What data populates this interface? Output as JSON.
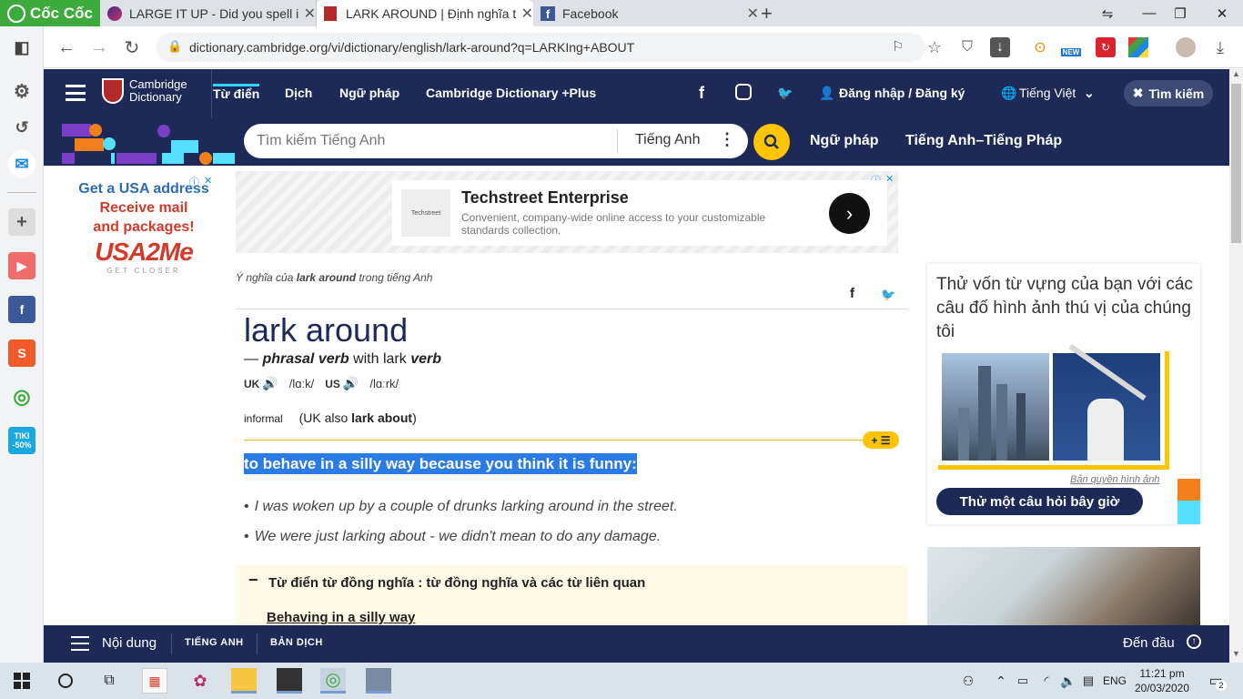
{
  "tabs": [
    {
      "label": "Cốc Cốc",
      "active": false
    },
    {
      "label": "LARGE IT UP - Did you spell it",
      "active": false
    },
    {
      "label": "LARK AROUND | Định nghĩa t",
      "active": true
    },
    {
      "label": "Facebook",
      "active": false
    }
  ],
  "address": {
    "url": "dictionary.cambridge.org/vi/dictionary/english/lark-around?q=LARKIng+ABOUT"
  },
  "toolbar": {
    "new_badge": "NEW"
  },
  "sidebar": {
    "tiki_label": "TIKI",
    "tiki_badge": "-50%"
  },
  "header": {
    "logo_line1": "Cambridge",
    "logo_line2": "Dictionary",
    "nav": [
      "Từ điển",
      "Dịch",
      "Ngữ pháp",
      "Cambridge Dictionary +Plus"
    ],
    "login": "Đăng nhập / Đăng ký",
    "language": "Tiếng Việt",
    "close_search": "Tìm kiếm"
  },
  "search": {
    "placeholder": "Tìm kiếm Tiếng Anh",
    "dictionary": "Tiếng Anh",
    "links": [
      "Ngữ pháp",
      "Tiếng Anh–Tiếng Pháp"
    ]
  },
  "ads": {
    "left": {
      "line1": "Get a USA address",
      "line2": "Receive mail",
      "line3": "and packages!",
      "brand": "USA2Me",
      "tagline": "GET CLOSER"
    },
    "top": {
      "title": "Techstreet Enterprise",
      "body": "Convenient, company-wide online access to your customizable standards collection.",
      "logo_text": "Techstreet"
    }
  },
  "entry": {
    "meaning_prefix": "Ý nghĩa của",
    "meaning_word": "lark around",
    "meaning_suffix": "trong tiếng Anh",
    "headword": "lark around",
    "pos_dash": "—",
    "pos": "phrasal verb",
    "pos_with": "with lark",
    "pos_verb": "verb",
    "uk_label": "UK",
    "uk_ipa": "/lɑːk/",
    "us_label": "US",
    "us_ipa": "/lɑːrk/",
    "register": "informal",
    "also_open": "(UK also",
    "also_word": "lark about",
    "also_close": ")",
    "definition": "to behave in a silly way because you think it is funny:",
    "examples": [
      "I was woken up by a couple of drunks larking around in the street.",
      "We were just larking about - we didn't mean to do any damage."
    ],
    "thesaurus_title": "Từ điển từ đồng nghĩa : từ đồng nghĩa và các từ liên quan",
    "thesaurus_link": "Behaving in a silly way"
  },
  "quiz": {
    "title": "Thử vốn từ vựng của bạn với các câu đố hình ảnh thú vị của chúng tôi",
    "credit": "Bản quyền hình ảnh",
    "button": "Thử một câu hỏi bây giờ"
  },
  "bottombar": {
    "contents": "Nội dung",
    "tab1": "TIẾNG ANH",
    "tab2": "BẢN DỊCH",
    "top": "Đến đầu"
  },
  "taskbar": {
    "lang": "ENG",
    "time": "11:21 pm",
    "date": "20/03/2020",
    "notif_count": "2"
  }
}
